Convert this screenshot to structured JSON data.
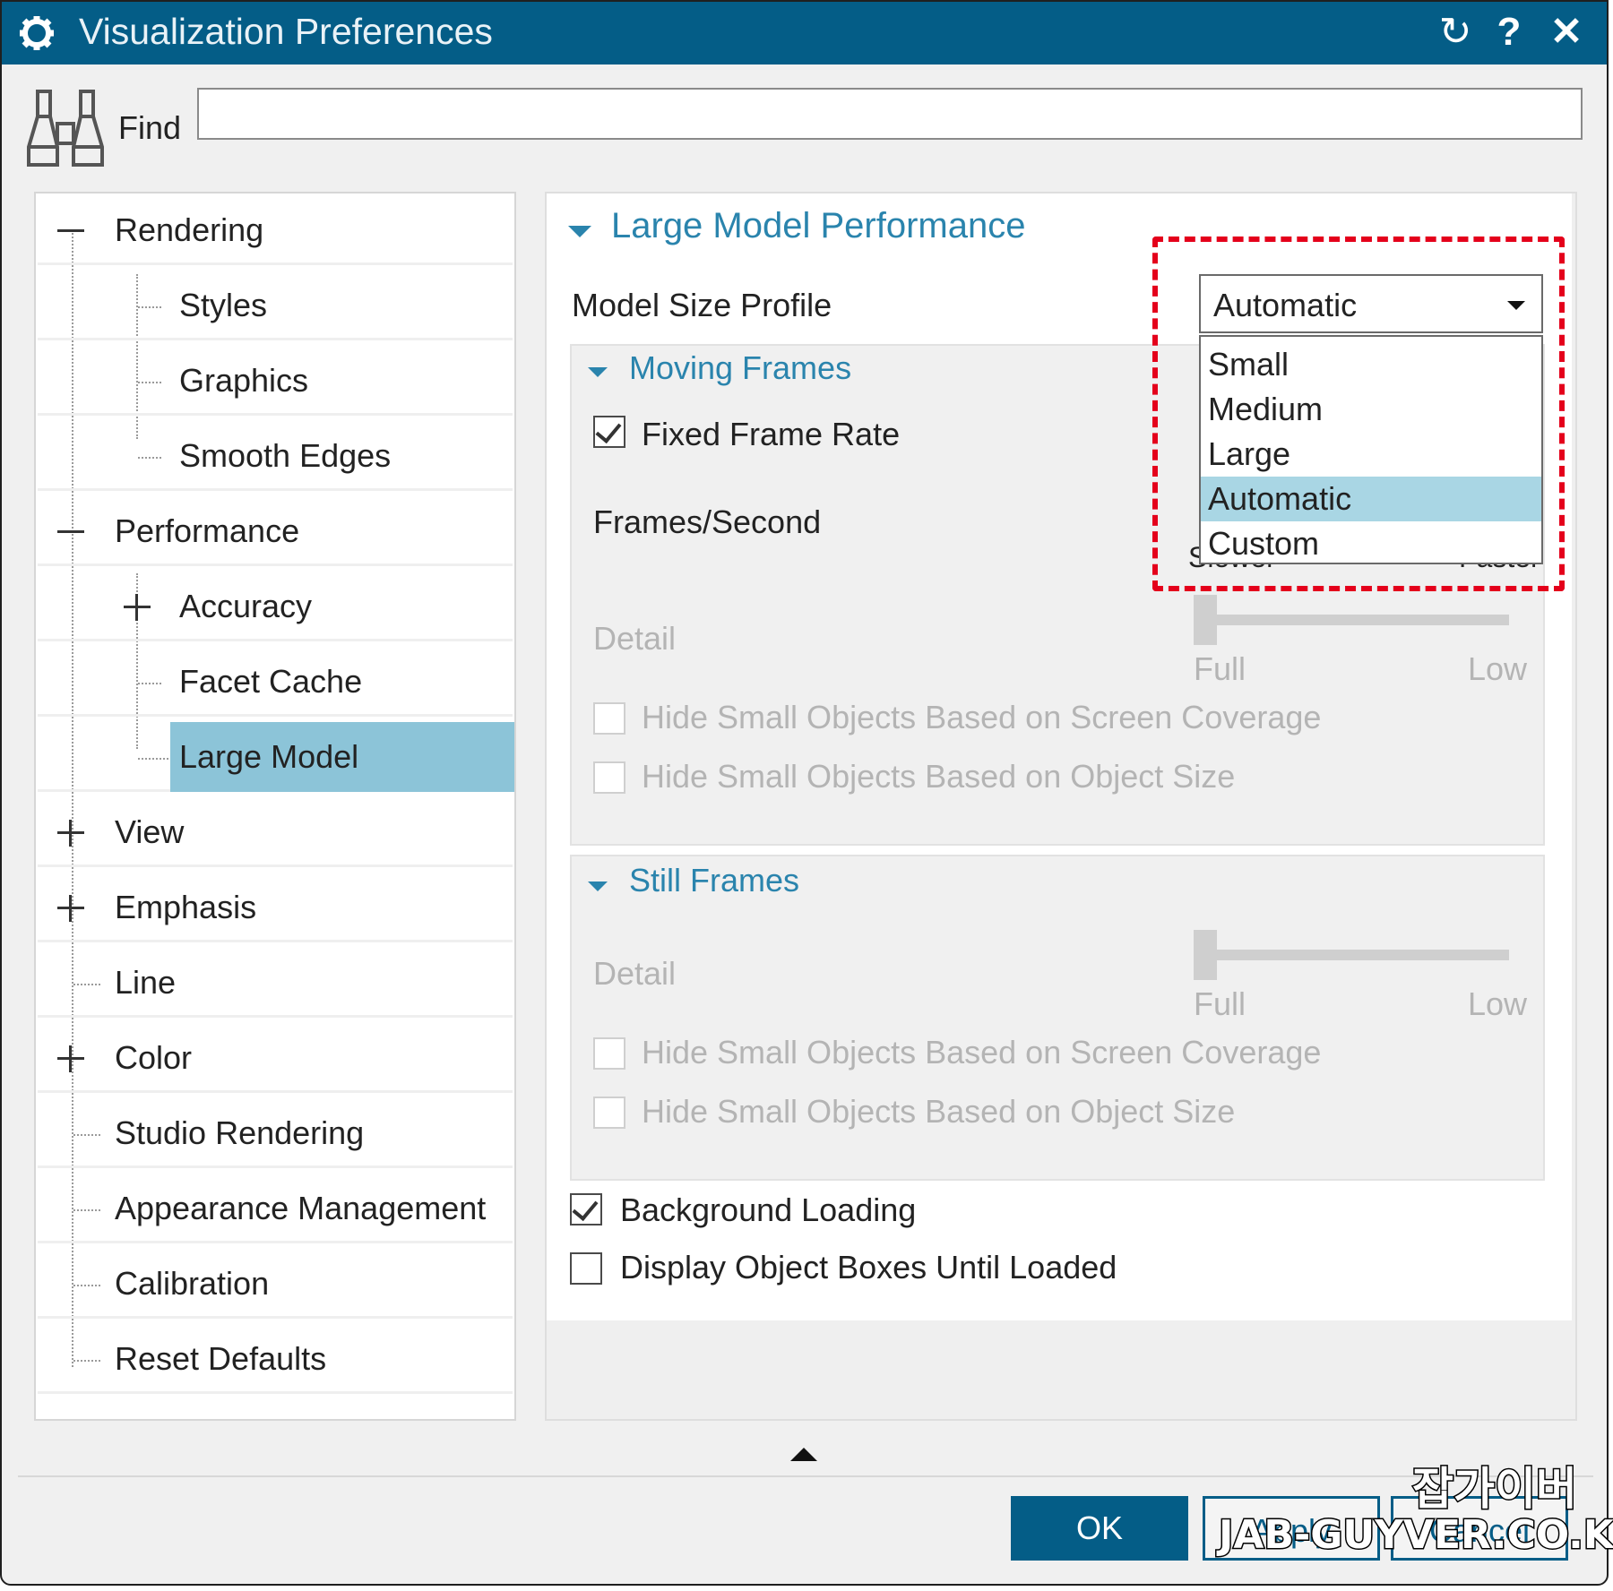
{
  "window": {
    "title": "Visualization Preferences",
    "accent": "#045d87"
  },
  "titlebar_buttons": {
    "reset": "↻",
    "help": "?",
    "close": "✕"
  },
  "find": {
    "label": "Find",
    "value": ""
  },
  "tree": {
    "rendering": "Rendering",
    "styles": "Styles",
    "graphics": "Graphics",
    "smooth_edges": "Smooth Edges",
    "performance": "Performance",
    "accuracy": "Accuracy",
    "facet_cache": "Facet Cache",
    "large_model": "Large Model",
    "view": "View",
    "emphasis": "Emphasis",
    "line": "Line",
    "color": "Color",
    "studio_rendering": "Studio Rendering",
    "appearance_management": "Appearance Management",
    "calibration": "Calibration",
    "reset_defaults": "Reset Defaults",
    "selected": "Large Model"
  },
  "panel": {
    "title": "Large Model Performance",
    "model_size_profile_label": "Model Size Profile",
    "model_size_profile_value": "Automatic",
    "dropdown_options": [
      "Small",
      "Medium",
      "Large",
      "Automatic",
      "Custom"
    ],
    "dropdown_selected": "Automatic",
    "moving_frames": {
      "title": "Moving Frames",
      "fixed_frame_rate": "Fixed Frame Rate",
      "fixed_frame_rate_checked": true,
      "frames_second": "Frames/Second",
      "slower": "Slower",
      "faster": "Faster",
      "detail": "Detail",
      "full": "Full",
      "low": "Low",
      "detail_level": 0,
      "hide_screen": "Hide Small Objects Based on Screen Coverage",
      "hide_size": "Hide Small Objects Based on Object Size"
    },
    "still_frames": {
      "title": "Still Frames",
      "detail": "Detail",
      "full": "Full",
      "low": "Low",
      "detail_level": 0,
      "hide_screen": "Hide Small Objects Based on Screen Coverage",
      "hide_size": "Hide Small Objects Based on Object Size"
    },
    "background_loading": "Background Loading",
    "background_loading_checked": true,
    "display_boxes": "Display Object Boxes Until Loaded",
    "display_boxes_checked": false
  },
  "buttons": {
    "ok": "OK",
    "apply": "Apply",
    "cancel": "Cancel"
  },
  "watermark": {
    "line1": "잡가이버",
    "line2": "JAB-GUYVER.CO.KR"
  }
}
